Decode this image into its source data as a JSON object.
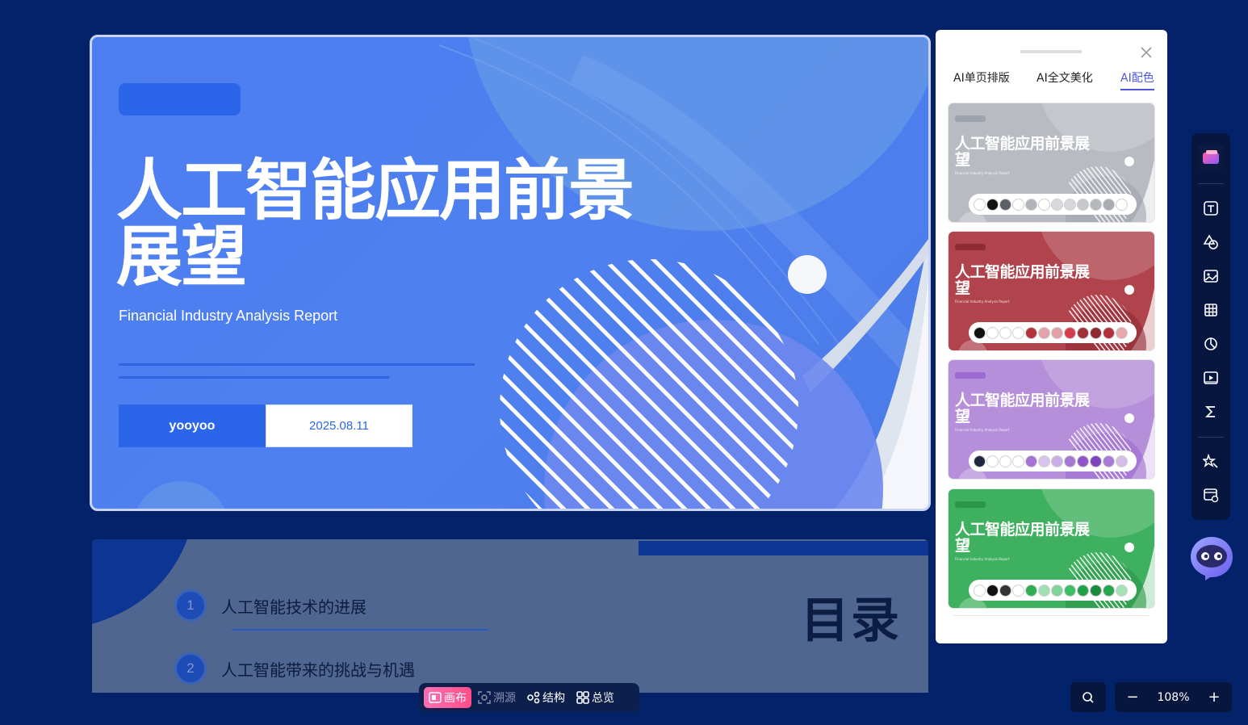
{
  "slide1": {
    "title": "人工智能应用前景展望",
    "subtitle": "Financial Industry Analysis Report",
    "author": "yooyoo",
    "date": "2025.08.11"
  },
  "slide2": {
    "heading": "目录",
    "items": [
      {
        "num": "1",
        "text": "人工智能技术的进展"
      },
      {
        "num": "2",
        "text": "人工智能带来的挑战与机遇"
      }
    ]
  },
  "panel": {
    "tabs": [
      {
        "label": "AI单页排版",
        "active": false
      },
      {
        "label": "AI全文美化",
        "active": false
      },
      {
        "label": "AI配色",
        "active": true
      }
    ],
    "cards": [
      {
        "title": "人工智能应用前景展望",
        "subtitle": "Financial Industry Analysis Report",
        "bg": "#b8bcc2",
        "accent": "#9ea3ab",
        "swatches": [
          "#ffffff",
          "#111111",
          "#5b6068",
          "#ffffff",
          "#b1b5bb",
          "#ffffff",
          "#d9dadd",
          "#d6d7da",
          "#c5c7cb",
          "#b5b8bd",
          "#a9acb2",
          "#ffffff"
        ]
      },
      {
        "title": "人工智能应用前景展望",
        "subtitle": "Financial Industry Analysis Report",
        "bg": "#b0434c",
        "accent": "#8f2a33",
        "swatches": [
          "#111111",
          "#ffffff",
          "#ffffff",
          "#ffffff",
          "#b2333e",
          "#e2a4aa",
          "#e1a0a6",
          "#d23e4d",
          "#a0303a",
          "#8f2a33",
          "#b3313d",
          "#e6a8ad"
        ]
      },
      {
        "title": "人工智能应用前景展望",
        "subtitle": "Financial Industry Analysis Report",
        "bg": "#b58fd9",
        "accent": "#9c6ad0",
        "swatches": [
          "#1e2640",
          "#ffffff",
          "#ffffff",
          "#ffffff",
          "#a373d5",
          "#d8c2ee",
          "#cbaee8",
          "#a678d6",
          "#8f55c9",
          "#7d45bd",
          "#a97bd9",
          "#d4bde9"
        ]
      },
      {
        "title": "人工智能应用前景展望",
        "subtitle": "Financial Industry Analysis Report",
        "bg": "#3fb05f",
        "accent": "#2c9648",
        "swatches": [
          "#ffffff",
          "#111111",
          "#333333",
          "#ffffff",
          "#2fae54",
          "#9fe0b1",
          "#7fd49a",
          "#3cbf64",
          "#21a048",
          "#1c8a3d",
          "#27a650",
          "#a5e3b6"
        ]
      }
    ]
  },
  "bottom_toolbar": {
    "canvas": "画布",
    "source": "溯源",
    "structure": "结构",
    "overview": "总览"
  },
  "zoom": {
    "minus": "−",
    "value": "108%",
    "plus": "+"
  },
  "colors": {
    "background": "#04226a",
    "slide_blue": "#4f80ef",
    "accent_blue": "#2b66ea",
    "tab_active": "#4d55e0",
    "canvas_btn": "#ff5a96"
  }
}
